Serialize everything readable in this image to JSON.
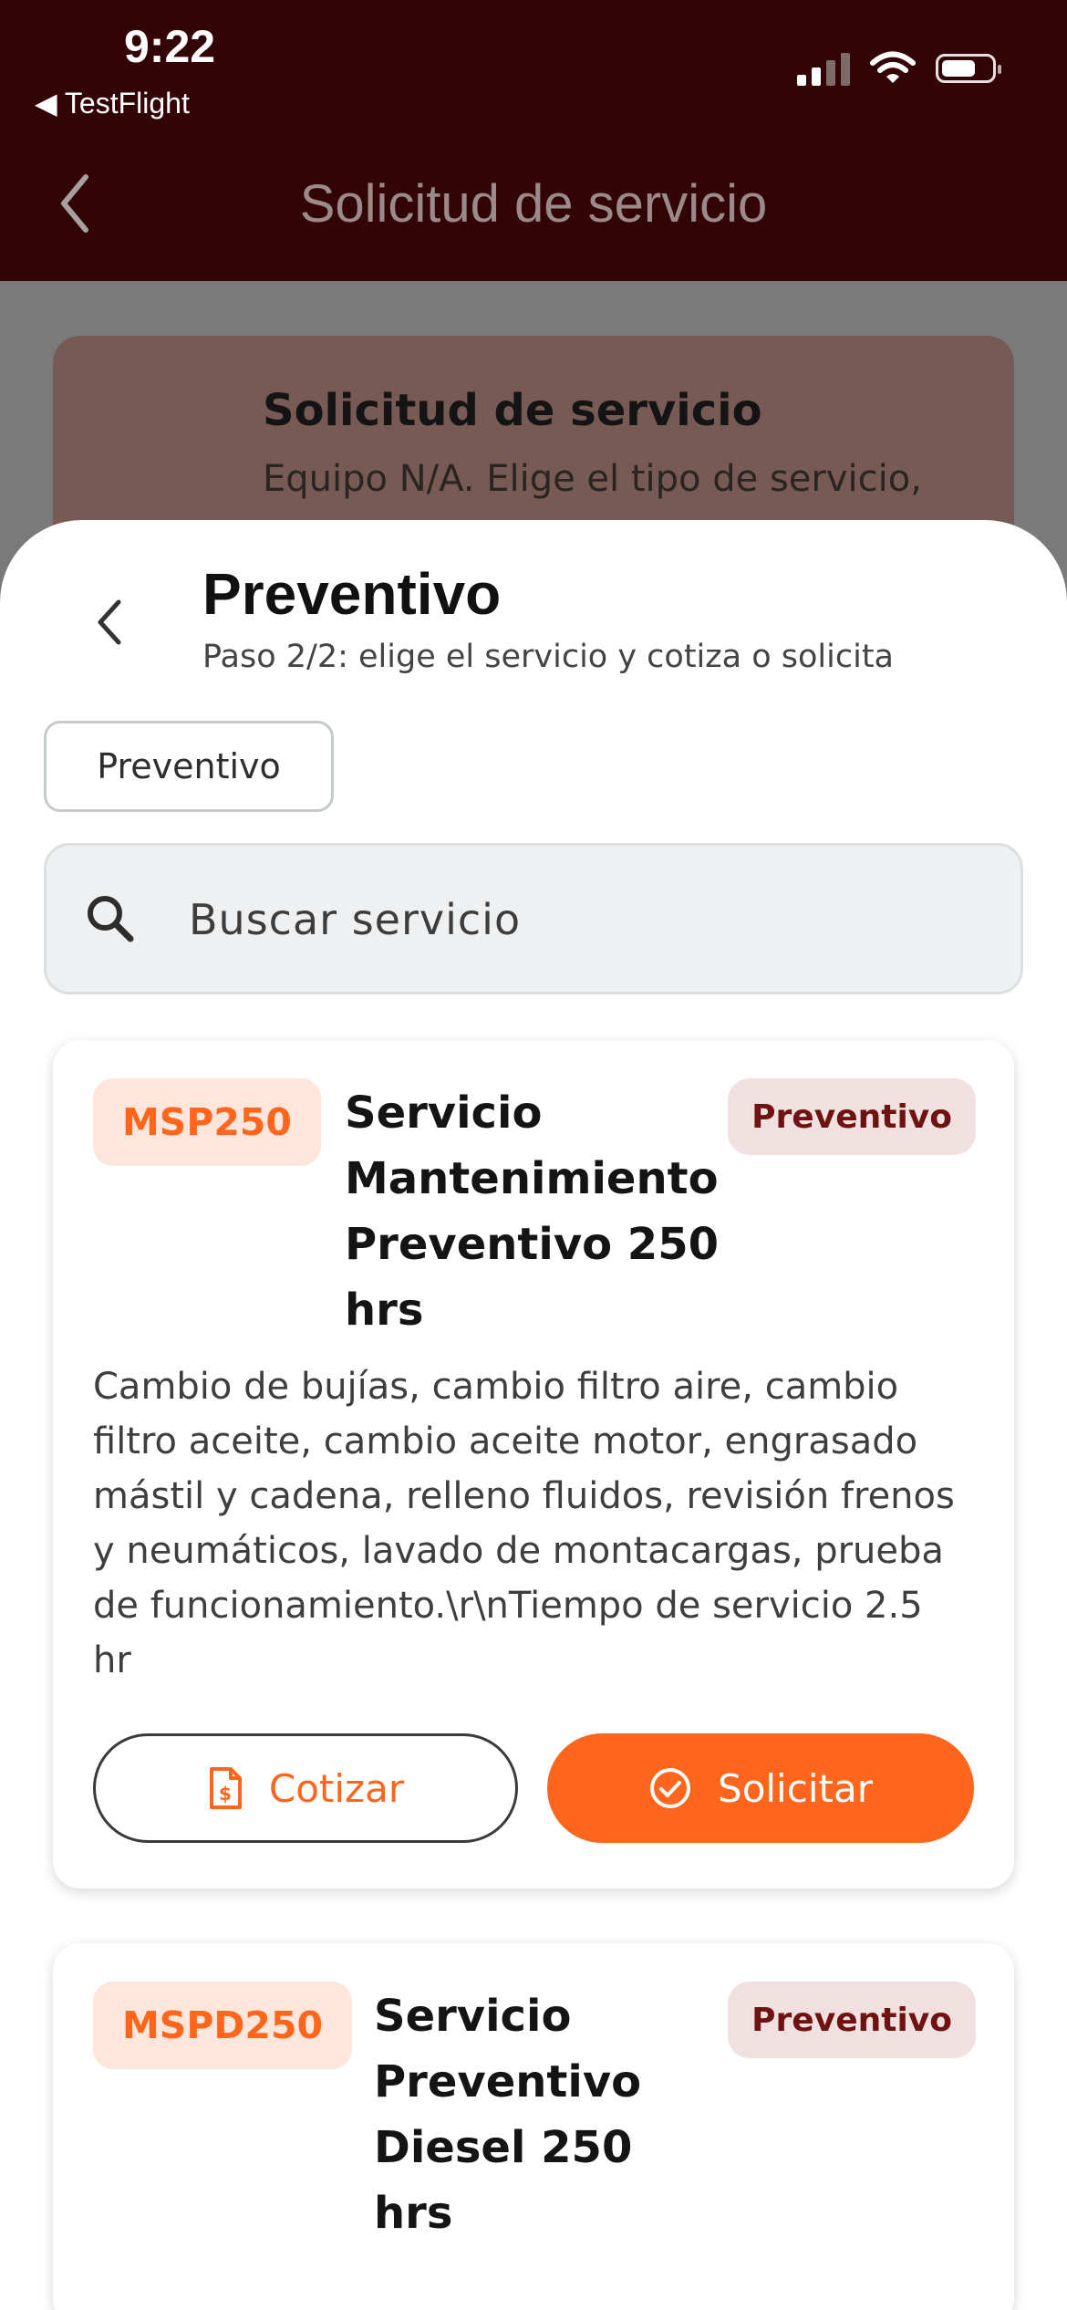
{
  "status_bar": {
    "time": "9:22",
    "back_app": "◀ TestFlight"
  },
  "nav": {
    "title": "Solicitud de servicio"
  },
  "background_card": {
    "title": "Solicitud de servicio",
    "subtitle": "Equipo N/A. Elige el tipo de servicio,"
  },
  "sheet": {
    "title": "Preventivo",
    "subtitle": "Paso 2/2: elige el servicio y cotiza o solicita",
    "filter_chip": "Preventivo",
    "search": {
      "placeholder": "Buscar servicio",
      "value": ""
    }
  },
  "services": [
    {
      "code": "MSP250",
      "title_lines": [
        "Servicio",
        "Mantenimiento",
        "Preventivo 250",
        "hrs"
      ],
      "type": "Preventivo",
      "description_lines": [
        "Cambio de bujías, cambio filtro aire, cambio",
        "filtro aceite, cambio aceite motor, engrasado",
        "mástil y cadena, relleno fluidos, revisión frenos",
        "y neumáticos, lavado de montacargas, prueba",
        "de funcionamiento.\\r\\nTiempo de servicio 2.5",
        "hr"
      ],
      "quote_label": "Cotizar",
      "request_label": "Solicitar"
    },
    {
      "code": "MSPD250",
      "title_lines": [
        "Servicio",
        "Preventivo",
        "Diesel 250",
        "hrs"
      ],
      "type": "Preventivo"
    }
  ],
  "colors": {
    "header": "#330405",
    "accent": "#fd661c",
    "badge_bg": "#ffe6dc",
    "type_badge_text": "#6e1212",
    "type_badge_bg": "#f1e0e0"
  },
  "icons": [
    "chevron-left-icon",
    "search-icon",
    "invoice-icon",
    "check-circle-icon",
    "wifi-icon",
    "battery-icon",
    "signal-icon"
  ]
}
